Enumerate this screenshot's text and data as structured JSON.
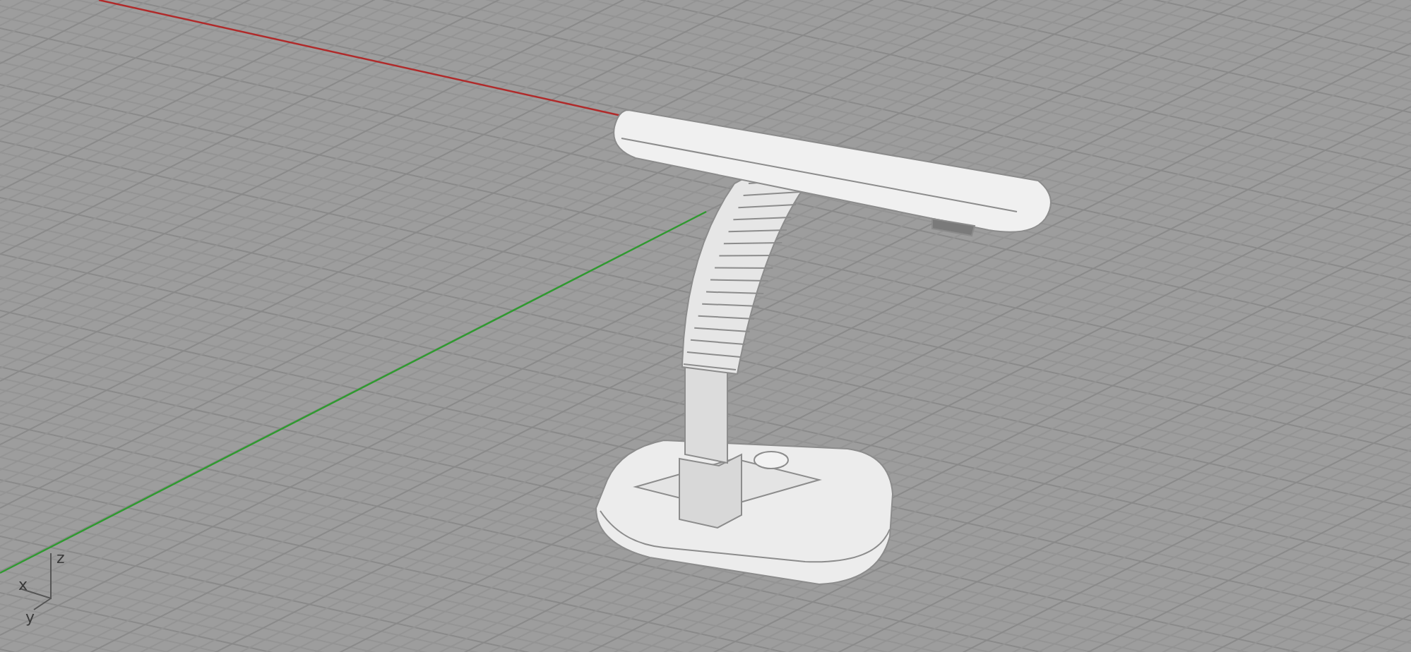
{
  "viewport": {
    "axis_labels": [
      "z",
      "x",
      "y"
    ]
  }
}
